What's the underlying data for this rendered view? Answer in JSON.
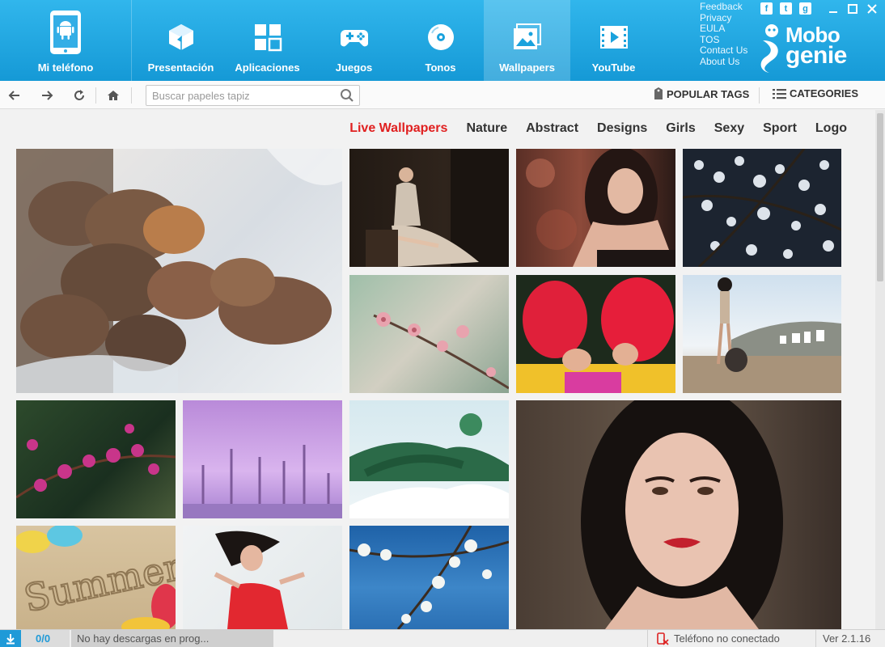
{
  "header": {
    "phone_label": "Mi teléfono",
    "nav": [
      {
        "label": "Presentación",
        "icon": "cube-icon"
      },
      {
        "label": "Aplicaciones",
        "icon": "apps-grid-icon"
      },
      {
        "label": "Juegos",
        "icon": "gamepad-icon"
      },
      {
        "label": "Tonos",
        "icon": "disc-icon"
      },
      {
        "label": "Wallpapers",
        "icon": "picture-icon",
        "active": true
      },
      {
        "label": "YouTube",
        "icon": "film-icon"
      }
    ],
    "links": [
      "Feedback",
      "Privacy",
      "EULA",
      "TOS",
      "Contact Us",
      "About Us"
    ],
    "social": [
      "f",
      "t",
      "g"
    ],
    "logo_line1": "Mobo",
    "logo_line2": "genie"
  },
  "toolbar": {
    "search_placeholder": "Buscar papeles tapiz",
    "popular_tags": "POPULAR TAGS",
    "categories": "CATEGORIES"
  },
  "categories": [
    {
      "label": "Live Wallpapers",
      "active": true
    },
    {
      "label": "Nature"
    },
    {
      "label": "Abstract"
    },
    {
      "label": "Designs"
    },
    {
      "label": "Girls"
    },
    {
      "label": "Sexy"
    },
    {
      "label": "Sport"
    },
    {
      "label": "Logo"
    }
  ],
  "wallpapers": [
    {
      "name": "wallpaper-dry-leaves-in-snow",
      "subject": "leaves"
    },
    {
      "name": "wallpaper-woman-in-gown",
      "subject": "gown"
    },
    {
      "name": "wallpaper-dark-haired-woman",
      "subject": "woman"
    },
    {
      "name": "wallpaper-white-blossom-branches",
      "subject": "blossom"
    },
    {
      "name": "wallpaper-pink-blossom-branch",
      "subject": "pink"
    },
    {
      "name": "wallpaper-red-hats",
      "subject": "hats"
    },
    {
      "name": "wallpaper-woman-on-road",
      "subject": "road"
    },
    {
      "name": "wallpaper-magenta-flowers",
      "subject": "flowers"
    },
    {
      "name": "wallpaper-purple-trees",
      "subject": "trees"
    },
    {
      "name": "wallpaper-snowy-fir",
      "subject": "fir"
    },
    {
      "name": "wallpaper-woman-portrait-red-lips",
      "subject": "portrait"
    },
    {
      "name": "wallpaper-summer-sand",
      "subject": "sand"
    },
    {
      "name": "wallpaper-woman-red-dress",
      "subject": "dress"
    },
    {
      "name": "wallpaper-blossom-blue-sky",
      "subject": "sky"
    }
  ],
  "summer_text": "Summer",
  "status": {
    "download_count": "0/0",
    "download_message": "No hay descargas en prog...",
    "phone_status": "Teléfono no conectado",
    "version": "Ver 2.1.16"
  },
  "colors": {
    "header": "#1aa2dd",
    "active_category": "#e02020"
  }
}
